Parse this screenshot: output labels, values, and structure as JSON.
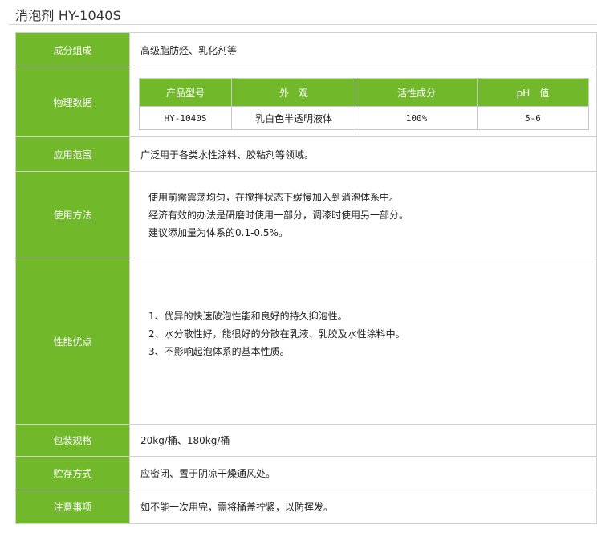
{
  "title": "消泡剂 HY-1040S",
  "labels": {
    "composition": "成分组成",
    "physical": "物理数据",
    "application": "应用范围",
    "usage": "使用方法",
    "advantages": "性能优点",
    "packaging": "包装规格",
    "storage": "贮存方式",
    "notes": "注意事项"
  },
  "composition": "高级脂肪烃、乳化剂等",
  "physical_table": {
    "headers": [
      "产品型号",
      "外　观",
      "活性成分",
      "pH　值"
    ],
    "row": [
      "HY-1040S",
      "乳白色半透明液体",
      "100%",
      "5-6"
    ]
  },
  "application": "广泛用于各类水性涂料、胶粘剂等领域。",
  "usage": [
    "使用前需震荡均匀，在搅拌状态下缓慢加入到消泡体系中。",
    "经济有效的办法是研磨时使用一部分，调漆时使用另一部分。",
    "建议添加量为体系的0.1-0.5%。"
  ],
  "advantages": [
    "1、优异的快速破泡性能和良好的持久抑泡性。",
    "2、水分散性好，能很好的分散在乳液、乳胶及水性涂料中。",
    "3、不影响起泡体系的基本性质。"
  ],
  "packaging": "20kg/桶、180kg/桶",
  "storage": "应密闭、置于阴凉干燥通风处。",
  "notes": "如不能一次用完，需将桶盖拧紧，以防挥发。",
  "colors": {
    "label_bg": "#71b82a",
    "border": "#d0d0d0"
  }
}
